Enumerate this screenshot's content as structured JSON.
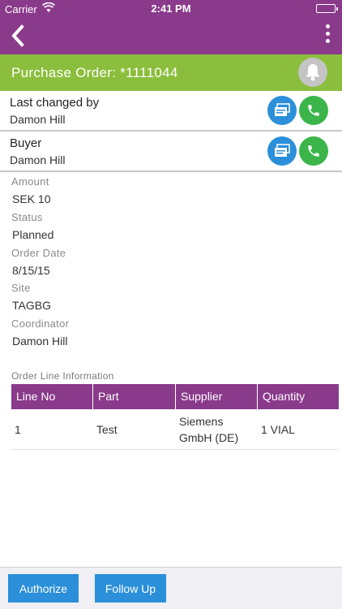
{
  "status_bar": {
    "carrier": "Carrier",
    "time": "2:41 PM"
  },
  "colors": {
    "nav": "#8a3a8b",
    "header": "#8bbe3c",
    "accent_blue": "#2b8fd9",
    "accent_green": "#3bb54a"
  },
  "icons": {
    "back": "chevron-left-icon",
    "more": "more-vertical-icon",
    "bell": "bell-icon",
    "card": "cards-icon",
    "phone": "phone-icon"
  },
  "header": {
    "title": "Purchase Order: *1111044"
  },
  "contacts": [
    {
      "label": "Last changed by",
      "name": "Damon Hill"
    },
    {
      "label": "Buyer",
      "name": "Damon Hill"
    }
  ],
  "details": [
    {
      "label": "Amount",
      "value": "SEK 10"
    },
    {
      "label": "Status",
      "value": "Planned"
    },
    {
      "label": "Order Date",
      "value": "8/15/15"
    },
    {
      "label": "Site",
      "value": "TAGBG"
    },
    {
      "label": "Coordinator",
      "value": "Damon Hill"
    }
  ],
  "order_lines": {
    "title": "Order Line Information",
    "columns": [
      "Line No",
      "Part",
      "Supplier",
      "Quantity"
    ],
    "rows": [
      [
        "1",
        "Test",
        "Siemens GmbH (DE)",
        "1 VIAL"
      ]
    ]
  },
  "footer": {
    "authorize": "Authorize",
    "follow_up": "Follow Up"
  }
}
